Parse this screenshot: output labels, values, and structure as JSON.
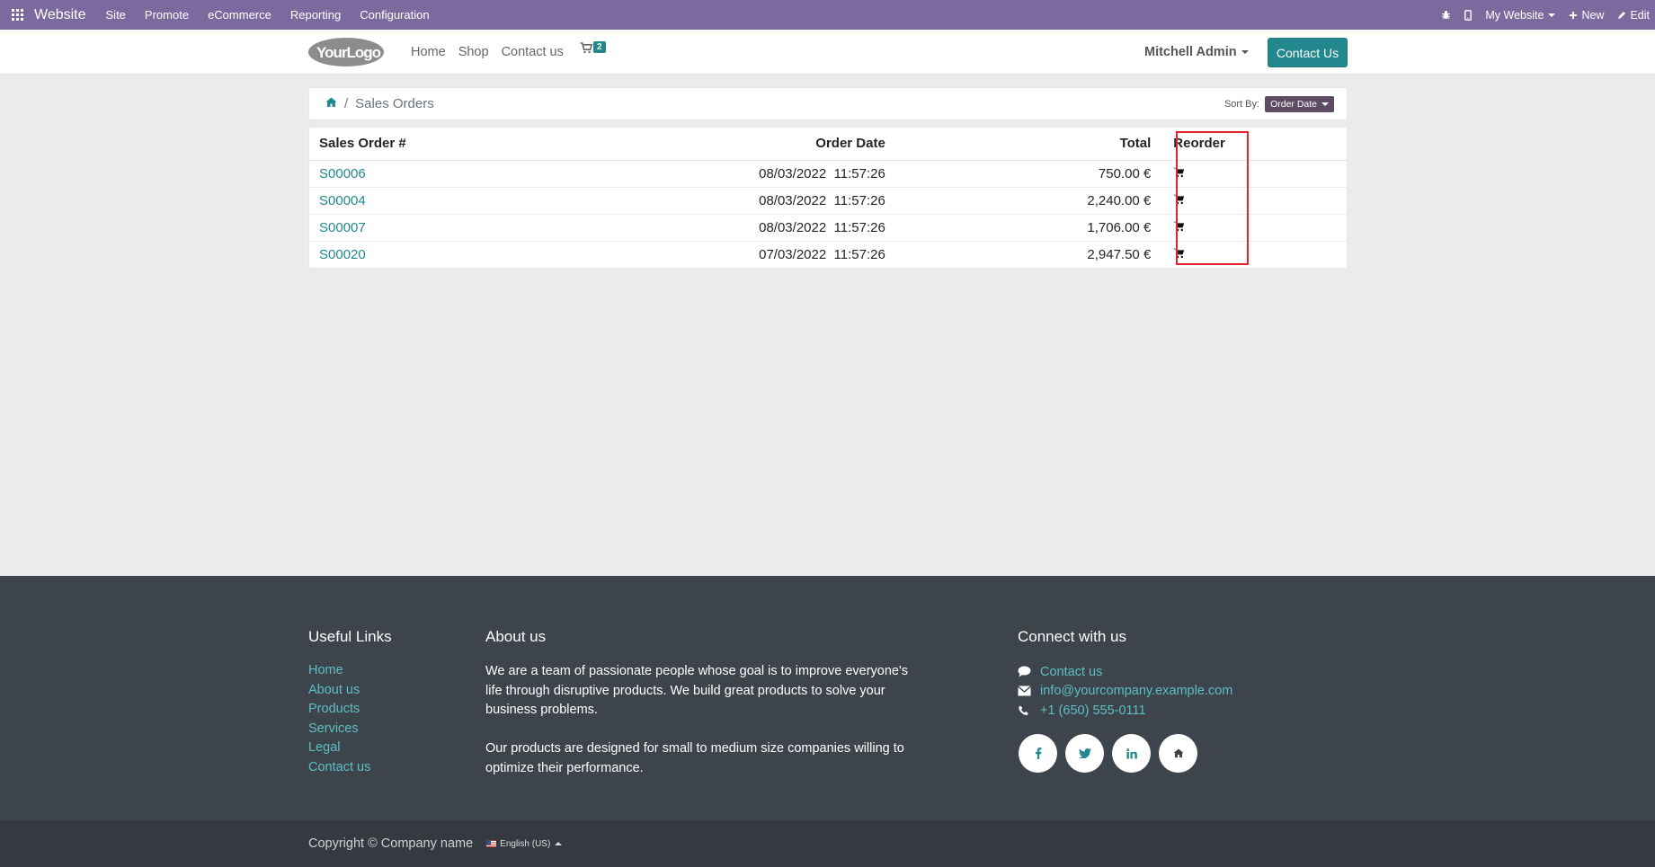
{
  "admin_bar": {
    "brand": "Website",
    "menus": [
      "Site",
      "Promote",
      "eCommerce",
      "Reporting",
      "Configuration"
    ],
    "website_selector": "My Website",
    "new_label": "New",
    "edit_label": "Edit"
  },
  "header": {
    "logo_text": "YourLogo",
    "nav": [
      "Home",
      "Shop",
      "Contact us"
    ],
    "cart_count": "2",
    "user": "Mitchell Admin",
    "contact_button": "Contact Us"
  },
  "breadcrumb": {
    "current": "Sales Orders",
    "sort_label": "Sort By:",
    "sort_value": "Order Date"
  },
  "orders": {
    "columns": [
      "Sales Order #",
      "Order Date",
      "Total",
      "Reorder"
    ],
    "rows": [
      {
        "number": "S00006",
        "date": "08/03/2022",
        "time": "11:57:26",
        "total": "750.00 €"
      },
      {
        "number": "S00004",
        "date": "08/03/2022",
        "time": "11:57:26",
        "total": "2,240.00 €"
      },
      {
        "number": "S00007",
        "date": "08/03/2022",
        "time": "11:57:26",
        "total": "1,706.00 €"
      },
      {
        "number": "S00020",
        "date": "07/03/2022",
        "time": "11:57:26",
        "total": "2,947.50 €"
      }
    ]
  },
  "footer": {
    "useful_links_title": "Useful Links",
    "useful_links": [
      "Home",
      "About us",
      "Products",
      "Services",
      "Legal",
      "Contact us"
    ],
    "about_title": "About us",
    "about_p1": "We are a team of passionate people whose goal is to improve everyone's life through disruptive products. We build great products to solve your business problems.",
    "about_p2": "Our products are designed for small to medium size companies willing to optimize their performance.",
    "connect_title": "Connect with us",
    "connect_contact": "Contact us",
    "connect_email": "info@yourcompany.example.com",
    "connect_phone": "+1 (650) 555-0111",
    "copyright": "Copyright © Company name",
    "language": "English (US)"
  },
  "colors": {
    "admin_bar": "#7c6a9e",
    "accent": "#23888d",
    "footer": "#3e444b",
    "highlight": "#e3242b"
  }
}
